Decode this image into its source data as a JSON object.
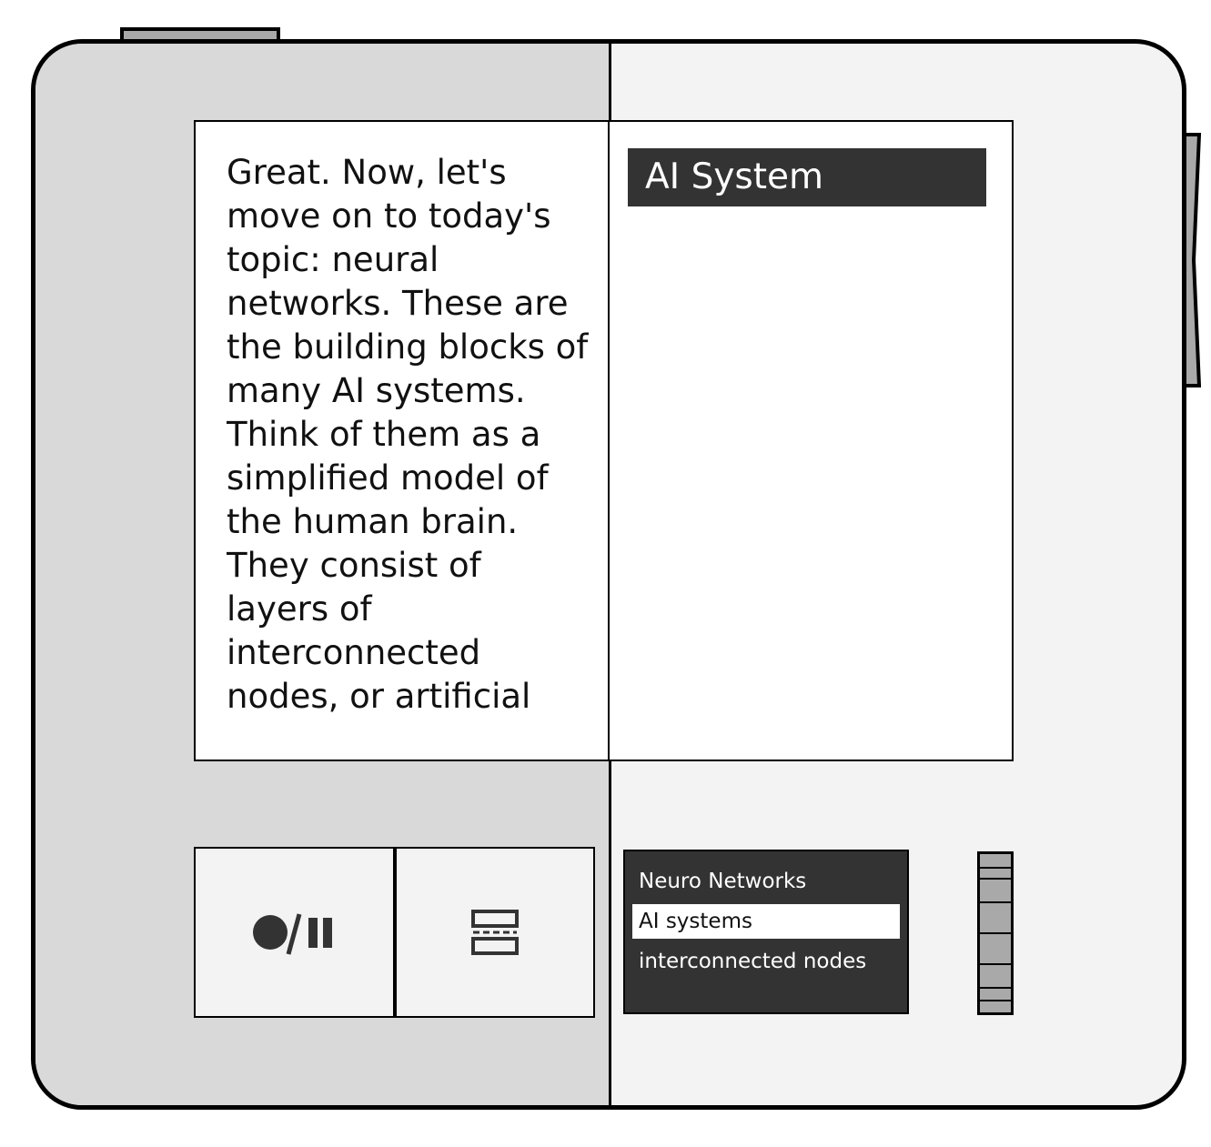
{
  "transcript": {
    "text": "Great. Now, let's move on to today's topic: neural networks. These are the building blocks of many AI systems. Think of them as a simplified model of the human brain. They consist of layers of interconnected nodes, or artificial neurons."
  },
  "panel": {
    "title": "AI System"
  },
  "controls": {
    "record_pause_icon": "record-pause-icon",
    "layout_icon": "split-layout-icon"
  },
  "topics": {
    "items": [
      {
        "label": "Neuro Networks",
        "selected": false
      },
      {
        "label": "AI systems",
        "selected": true
      },
      {
        "label": "interconnected nodes",
        "selected": false
      }
    ]
  },
  "colors": {
    "dark_panel": "#333333",
    "left_body": "#d9d9d9",
    "right_body": "#f3f3f3",
    "accent_gray": "#a9a9a9"
  }
}
